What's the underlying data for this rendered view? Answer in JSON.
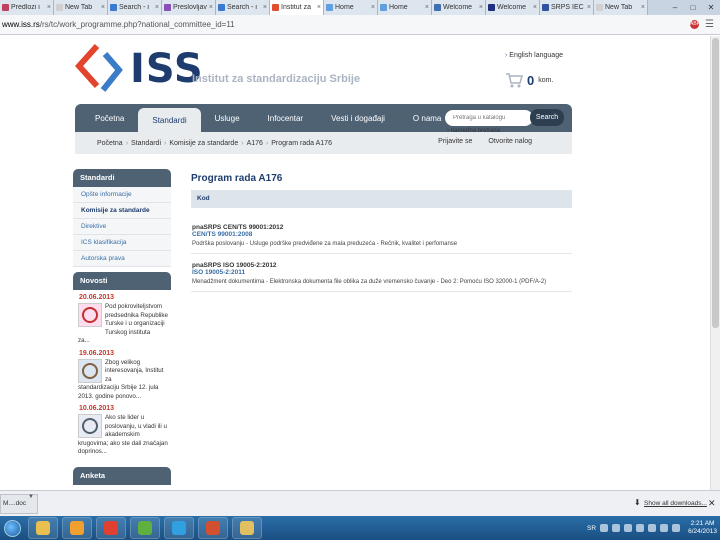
{
  "browser": {
    "tabs": [
      {
        "title": "Predlozi i",
        "color": "#c04060",
        "active": false
      },
      {
        "title": "New Tab",
        "color": "#d0d0d0",
        "active": false
      },
      {
        "title": "Search - i",
        "color": "#3a7ad0",
        "active": false
      },
      {
        "title": "Preslovljav",
        "color": "#8a4fb8",
        "active": false
      },
      {
        "title": "Search - i",
        "color": "#3a7ad0",
        "active": false
      },
      {
        "title": "Institut za",
        "color": "#e05030",
        "active": true
      },
      {
        "title": "Home",
        "color": "#60a0e0",
        "active": false
      },
      {
        "title": "Home",
        "color": "#60a0e0",
        "active": false
      },
      {
        "title": "Welcome",
        "color": "#4070b0",
        "active": false
      },
      {
        "title": "Welcome",
        "color": "#203080",
        "active": false
      },
      {
        "title": "SRPS IEC",
        "color": "#3050a0",
        "active": false
      },
      {
        "title": "New Tab",
        "color": "#d0d0d0",
        "active": false
      }
    ],
    "url_host": "www.iss.rs",
    "url_path": "/rs/tc/work_programme.php?national_committee_id=11",
    "win_minimize": "–",
    "win_maximize": "□",
    "win_close": "✕"
  },
  "site": {
    "logo_text": "ISS",
    "logo_subtitle": "Institut za standardizaciju Srbije",
    "language_link": "English language",
    "cart_count": "0",
    "cart_unit": "kom.",
    "nav": [
      "Početna",
      "Standardi",
      "Usluge",
      "Infocentar",
      "Vesti i događaji",
      "O nama"
    ],
    "nav_active_index": 1,
    "search_placeholder": "Pretraga u katalogu",
    "search_button": "Search",
    "advanced_search": "napredna pretraga",
    "breadcrumb": [
      "Početna",
      "Standardi",
      "Komisije za standarde",
      "A176",
      "Program rada A176"
    ],
    "login_link": "Prijavite se",
    "register_link": "Otvorite nalog"
  },
  "sidebar": {
    "heading": "Standardi",
    "items": [
      {
        "label": "Opšte informacije",
        "active": false
      },
      {
        "label": "Komisije za standarde",
        "active": true
      },
      {
        "label": "Direktive",
        "active": false
      },
      {
        "label": "ICS klasifikacija",
        "active": false
      },
      {
        "label": "Autorska prava",
        "active": false
      }
    ],
    "news_heading": "Novosti",
    "news": [
      {
        "date": "20.06.2013",
        "text": "Pod pokroviteljstvom predsednika Republike Turske i u organizaciji Turskog instituta",
        "more": "za..."
      },
      {
        "date": "19.06.2013",
        "text": "Zbog velikog interesovanja, Institut za",
        "more": "standardizaciju Srbije 12. jula 2013. godine ponovo..."
      },
      {
        "date": "10.06.2013",
        "text": "Ako ste lider u poslovanju, u vladi ili u akademskim",
        "more": "krugovima; ako ste dali značajan doprinos..."
      }
    ],
    "poll_heading": "Anketa"
  },
  "main": {
    "title": "Program rada A176",
    "column_header": "Kod",
    "entries": [
      {
        "code": "pnaSRPS CEN/TS 99001:2012",
        "ref": "CEN/TS 99001:2008",
        "desc": "Podrška poslovanju - Usluge podrške predviđene za mala preduzeća - Rečnik, kvalitet i perfomanse"
      },
      {
        "code": "pnaSRPS ISO 19005-2:2012",
        "ref": "ISO 19005-2:2011",
        "desc": "Menadžment dokumentima - Elektronska dokumenta file oblika za duže vremensko čuvanje - Deo 2: Pomoću ISO 32000-1 (PDF/A-2)"
      }
    ]
  },
  "downloads": {
    "item_label": "M....doc",
    "show_all": "Show all downloads...",
    "close": "✕"
  },
  "taskbar": {
    "apps": [
      {
        "name": "explorer",
        "color": "#e8c050"
      },
      {
        "name": "media-player",
        "color": "#f0a030"
      },
      {
        "name": "chrome",
        "color": "#e04030"
      },
      {
        "name": "utorrent",
        "color": "#60b040"
      },
      {
        "name": "skype",
        "color": "#30a0e0"
      },
      {
        "name": "presentation",
        "color": "#d05030"
      },
      {
        "name": "paint",
        "color": "#e0c060"
      }
    ],
    "lang": "SR",
    "time": "2:21 AM",
    "date": "6/24/2013"
  }
}
